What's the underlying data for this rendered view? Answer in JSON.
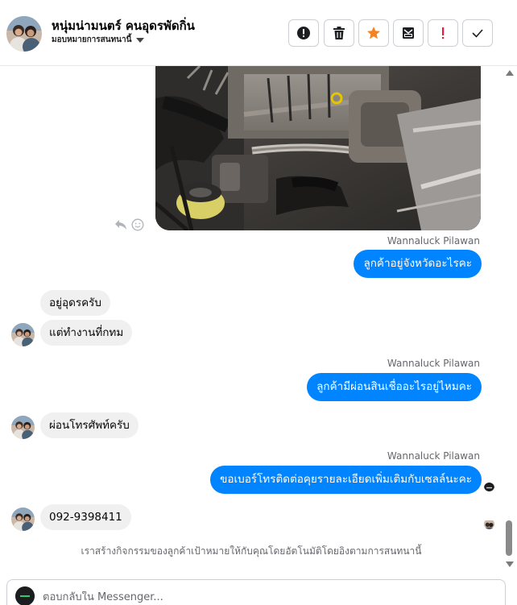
{
  "header": {
    "contact_name": "หนุ่มน่ามนตร์ คนอุดรพัดกิ่น",
    "assign_label": "มอบหมายการสนทนานี้",
    "actions": [
      {
        "name": "spam-button",
        "icon": "exclamation-circle-icon"
      },
      {
        "name": "delete-button",
        "icon": "trash-icon"
      },
      {
        "name": "star-button",
        "icon": "star-icon",
        "color": "#f5831f"
      },
      {
        "name": "mark-unread-button",
        "icon": "envelope-icon"
      },
      {
        "name": "follow-up-button",
        "icon": "exclamation-icon",
        "color": "#e41e3f"
      },
      {
        "name": "mark-done-button",
        "icon": "check-icon"
      }
    ]
  },
  "messages": [
    {
      "direction": "out",
      "sender": "Wannaluck Pilawan",
      "text": "ลูกค้าอยู่จังหวัดอะไรคะ"
    },
    {
      "direction": "in",
      "text": "อยู่อุดรครับ"
    },
    {
      "direction": "in",
      "text": "แต่ทำงานที่กทม"
    },
    {
      "direction": "out",
      "sender": "Wannaluck Pilawan",
      "text": "ลูกค้ามีผ่อนสินเชื่ออะไรอยู่ไหมคะ"
    },
    {
      "direction": "in",
      "text": "ผ่อนโทรศัพท์ครับ"
    },
    {
      "direction": "out",
      "sender": "Wannaluck Pilawan",
      "text": "ขอเบอร์โทรติดต่อคุยรายละเอียดเพิ่มเติมกับเซลล์นะคะ"
    },
    {
      "direction": "in",
      "text": "092-9398411"
    }
  ],
  "system_note": "เราสร้างกิจกรรมของลูกค้าเป้าหมายให้กับคุณโดยอัตโนมัติโดยอิงตามการสนทนานี้",
  "composer": {
    "placeholder": "ตอบกลับใน Messenger..."
  },
  "colors": {
    "outgoing_bubble": "#0084ff",
    "incoming_bubble": "#f0f0f0",
    "star": "#f5831f",
    "alert": "#e41e3f"
  }
}
